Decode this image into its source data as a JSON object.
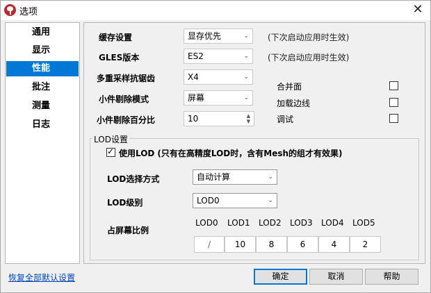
{
  "window": {
    "title": "选项"
  },
  "sidebar": {
    "items": [
      {
        "label": "通用"
      },
      {
        "label": "显示"
      },
      {
        "label": "性能",
        "active": true
      },
      {
        "label": "批注"
      },
      {
        "label": "测量"
      },
      {
        "label": "日志"
      }
    ]
  },
  "performance": {
    "cache": {
      "label": "缓存设置",
      "value": "显存优先",
      "note": "(下次启动应用时生效)"
    },
    "gles": {
      "label": "GLES版本",
      "value": "ES2",
      "note": "(下次启动应用时生效)"
    },
    "msaa": {
      "label": "多重采样抗锯齿",
      "value": "X4"
    },
    "cull_mode": {
      "label": "小件剔除模式",
      "value": "屏幕"
    },
    "cull_percent": {
      "label": "小件剔除百分比",
      "value": "10"
    },
    "merge": {
      "label": "合并面",
      "checked": false
    },
    "load_edges": {
      "label": "加载边线",
      "checked": false
    },
    "debug": {
      "label": "调试",
      "checked": false
    }
  },
  "lod": {
    "group_title": "LOD设置",
    "use_lod": {
      "label": "使用LOD",
      "hint": "(只有在高精度LOD时，含有Mesh的组才有效果)",
      "checked": true
    },
    "select_mode": {
      "label": "LOD选择方式",
      "value": "自动计算"
    },
    "level": {
      "label": "LOD级别",
      "value": "LOD0"
    },
    "ratio_label": "占屏幕比例",
    "columns": [
      "LOD0",
      "LOD1",
      "LOD2",
      "LOD3",
      "LOD4",
      "LOD5"
    ],
    "ratios": [
      "/",
      "10",
      "8",
      "6",
      "4",
      "2"
    ]
  },
  "footer": {
    "reset": "恢复全部默认设置",
    "ok": "确定",
    "cancel": "取消",
    "help": "帮助"
  },
  "colors": {
    "accent": "#0078d7",
    "link": "#0046c7",
    "icon": "#c0262d"
  }
}
